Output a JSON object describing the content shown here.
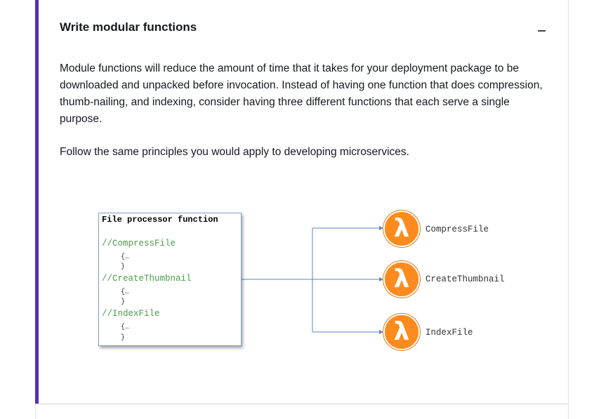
{
  "section": {
    "title": "Write modular functions",
    "paragraphs": [
      "Module functions will reduce the amount of time that it takes for your deployment package to be downloaded and unpacked before invocation. Instead of having one function that does compression, thumb-nailing, and indexing, consider having three different functions that each serve a single purpose.",
      "Follow the same principles you would apply to developing microservices."
    ],
    "collapse_icon": "minus-icon"
  },
  "diagram": {
    "box_title": "File processor function",
    "code_lines": [
      {
        "comment": "//CompressFile",
        "open": "{…",
        "close": "}"
      },
      {
        "comment": "//CreateThumbnail",
        "open": "{…",
        "close": "}"
      },
      {
        "comment": "//IndexFile",
        "open": "{…",
        "close": "}"
      }
    ],
    "functions": [
      {
        "name": "CompressFile",
        "icon": "lambda-icon"
      },
      {
        "name": "CreateThumbnail",
        "icon": "lambda-icon"
      },
      {
        "name": "IndexFile",
        "icon": "lambda-icon"
      }
    ],
    "colors": {
      "accent_bar": "#5a2fa6",
      "lambda": "#ff8a1d",
      "connector": "#5b86c0",
      "comment": "#4a9a4a"
    }
  }
}
